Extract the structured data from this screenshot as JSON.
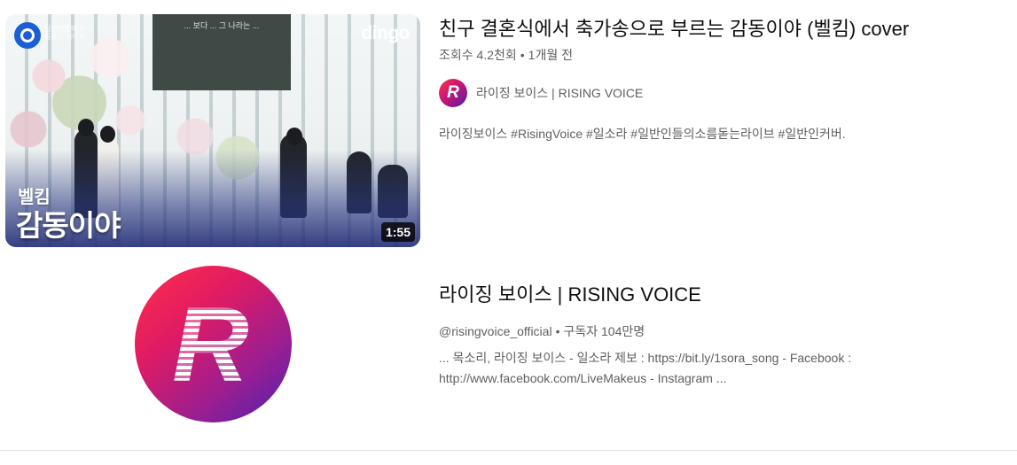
{
  "video": {
    "title": "친구 결혼식에서 축가송으로 부르는 감동이야 (벨킴) cover",
    "views": "조회수 4.2천회",
    "age": "1개월 전",
    "separator": "•",
    "channel_name": "라이징 보이스 | RISING VOICE",
    "avatar_letter": "R",
    "description": "라이징보이스 #RisingVoice #일소라 #일반인들의소름돋는라이브 #일반인커버.",
    "thumbnail": {
      "badge_caption": "일반인들의 소름돋는 라이브",
      "screen_text": "... 보다 ... 그 나라는 ...",
      "watermark": "dingo",
      "subtitle": "벨킴",
      "big_text": "감동이야",
      "duration": "1:55"
    }
  },
  "channel": {
    "title": "라이징 보이스 | RISING VOICE",
    "handle": "@risingvoice_official",
    "separator": "•",
    "subscribers": "구독자 104만명",
    "avatar_letter": "R",
    "description": "... 목소리, 라이징 보이스 - 일소라 제보 : https://bit.ly/1sora_song - Facebook : http://www.facebook.com/LiveMakeus - Instagram ..."
  },
  "colors": {
    "title_text": "#0f0f0f",
    "secondary_text": "#606060",
    "avatar_gradient_start": "#ff2f4a",
    "avatar_gradient_end": "#4a22b0",
    "duration_bg": "#000000"
  }
}
